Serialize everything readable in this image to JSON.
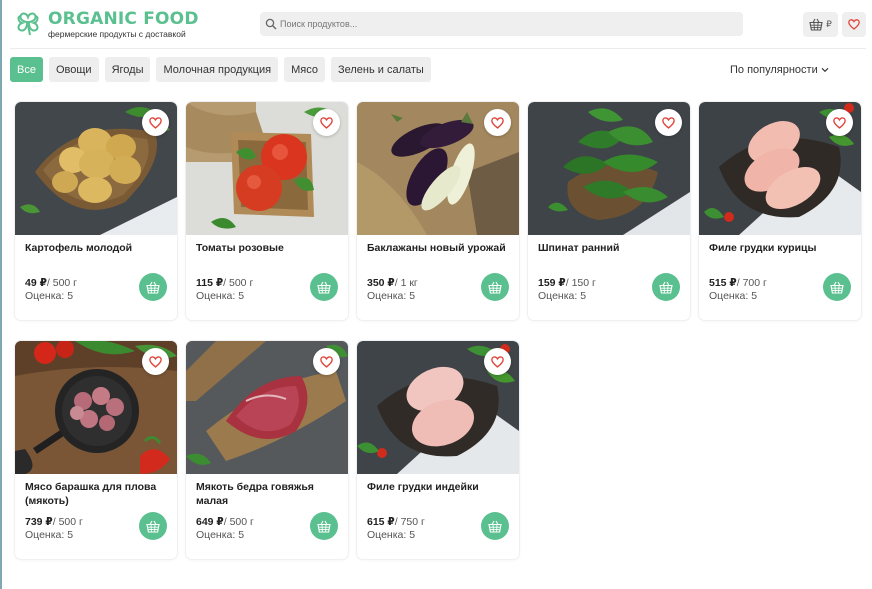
{
  "brand": {
    "title": "ORGANIC FOOD",
    "subtitle": "фермерские продукты с доставкой",
    "accent": "#5bc08f"
  },
  "search": {
    "placeholder": "Поиск продуктов..."
  },
  "header": {
    "cart_currency": "₽"
  },
  "filters": [
    {
      "label": "Все",
      "active": true
    },
    {
      "label": "Овощи",
      "active": false
    },
    {
      "label": "Ягоды",
      "active": false
    },
    {
      "label": "Молочная продукция",
      "active": false
    },
    {
      "label": "Мясо",
      "active": false
    },
    {
      "label": "Зелень и салаты",
      "active": false
    }
  ],
  "sort": {
    "label": "По популярности"
  },
  "products": [
    {
      "name": "Картофель молодой",
      "price": "49 ₽",
      "unit": "/ 500 г",
      "rating": "Оценка: 5",
      "photo": "potato"
    },
    {
      "name": "Томаты розовые",
      "price": "115 ₽",
      "unit": "/ 500 г",
      "rating": "Оценка: 5",
      "photo": "tomato"
    },
    {
      "name": "Баклажаны новый урожай",
      "price": "350 ₽",
      "unit": "/ 1 кг",
      "rating": "Оценка: 5",
      "photo": "eggplant"
    },
    {
      "name": "Шпинат ранний",
      "price": "159 ₽",
      "unit": "/ 150 г",
      "rating": "Оценка: 5",
      "photo": "spinach"
    },
    {
      "name": "Филе грудки курицы",
      "price": "515 ₽",
      "unit": "/ 700 г",
      "rating": "Оценка: 5",
      "photo": "chicken"
    },
    {
      "name": "Мясо барашка для плова (мякоть)",
      "price": "739 ₽",
      "unit": "/ 500 г",
      "rating": "Оценка: 5",
      "photo": "lamb"
    },
    {
      "name": "Мякоть бедра говяжья малая",
      "price": "649 ₽",
      "unit": "/ 500 г",
      "rating": "Оценка: 5",
      "photo": "beef"
    },
    {
      "name": "Филе грудки индейки",
      "price": "615 ₽",
      "unit": "/ 750 г",
      "rating": "Оценка: 5",
      "photo": "turkey"
    }
  ]
}
